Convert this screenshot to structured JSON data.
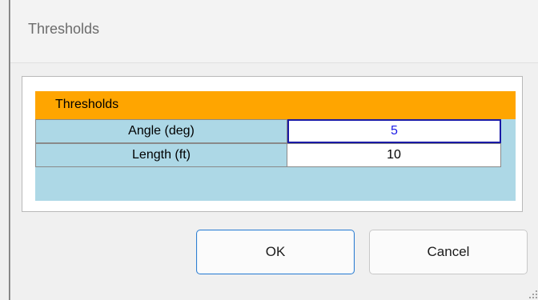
{
  "window": {
    "title": "Thresholds"
  },
  "grid": {
    "header": "Thresholds",
    "rows": [
      {
        "label": "Angle (deg)",
        "value": "5"
      },
      {
        "label": "Length (ft)",
        "value": "10"
      }
    ]
  },
  "buttons": {
    "ok_label": "OK",
    "cancel_label": "Cancel"
  },
  "colors": {
    "header_bg": "#ffa500",
    "grid_bg": "#add8e6",
    "selection_border": "#1a1aa6",
    "ok_focus_border": "#2f7fd1"
  }
}
